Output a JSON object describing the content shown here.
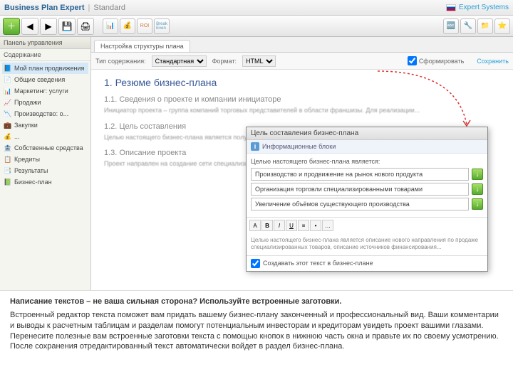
{
  "titlebar": {
    "app": "Business Plan Expert",
    "mode": "Standard",
    "brand": "Expert Systems"
  },
  "sidebar": {
    "header": "Панель управления",
    "sub": "Содержание",
    "items": [
      {
        "icon": "📘",
        "label": "Мой план продвижения",
        "sel": true
      },
      {
        "icon": "📄",
        "label": "Общие сведения"
      },
      {
        "icon": "📊",
        "label": "Маркетинг: услуги"
      },
      {
        "icon": "📈",
        "label": "Продажи"
      },
      {
        "icon": "📉",
        "label": "Производство: о..."
      },
      {
        "icon": "💼",
        "label": "Закупки"
      },
      {
        "icon": "💰",
        "label": "..."
      },
      {
        "icon": "🏦",
        "label": "Собственные средства"
      },
      {
        "icon": "📋",
        "label": "Кредиты"
      },
      {
        "icon": "📑",
        "label": "Результаты"
      },
      {
        "icon": "📗",
        "label": "Бизнес-план"
      }
    ]
  },
  "tab": {
    "label": "Настройка структуры плана"
  },
  "optbar": {
    "label1": "Тип содержания:",
    "val1": "Стандартная",
    "label2": "Формат:",
    "val2": "HTML",
    "chk": "Сформировать",
    "save": "Сохранить"
  },
  "doc": {
    "h1": "1. Резюме бизнес-плана",
    "h2a": "1.1. Сведения о проекте и компании инициаторе",
    "pa": "Инициатор проекта – группа компаний торговых представителей в области франшизы. Для реализации...",
    "h2b": "1.2. Цель составления",
    "pb": "Целью настоящего бизнес-плана является получение кредита в размере 5 млн руб. – кафе, а также...",
    "h2c": "1.3. Описание проекта",
    "pc": "Проект направлен на создание сети специализированных магазинов по продаже и ремонту бытовой техники..."
  },
  "popup": {
    "title": "Цель составления бизнес-плана",
    "subtitle": "Информационные блоки",
    "label": "Целью настоящего бизнес-плана является:",
    "opts": [
      "Производство и продвижение на рынок нового продукта",
      "Организация торговли специализированными товарами",
      "Увеличение объёмов существующего производства"
    ],
    "txt": "Целью настоящего бизнес-плана является описание нового направления по продаже специализированных товаров, описание источников финансирования...",
    "foot": "Создавать этот текст в бизнес-плане"
  },
  "caption": {
    "bold": "Написание текстов – не ваша сильная сторона? Используйте встроенные заготовки.",
    "body": "Встроенный редактор текста поможет вам придать вашему бизнес-плану законченный и профессиональный вид. Ваши комментарии и выводы к расчетным таблицам и разделам помогут потенциальным инвесторам и кредиторам увидеть проект вашими глазами. Перенесите полезные вам встроенные заготовки текста с помощью кнопок в нижнюю часть окна и правьте их по своему усмотрению. После сохранения отредактированный текст автоматически войдет в раздел бизнес-плана."
  }
}
